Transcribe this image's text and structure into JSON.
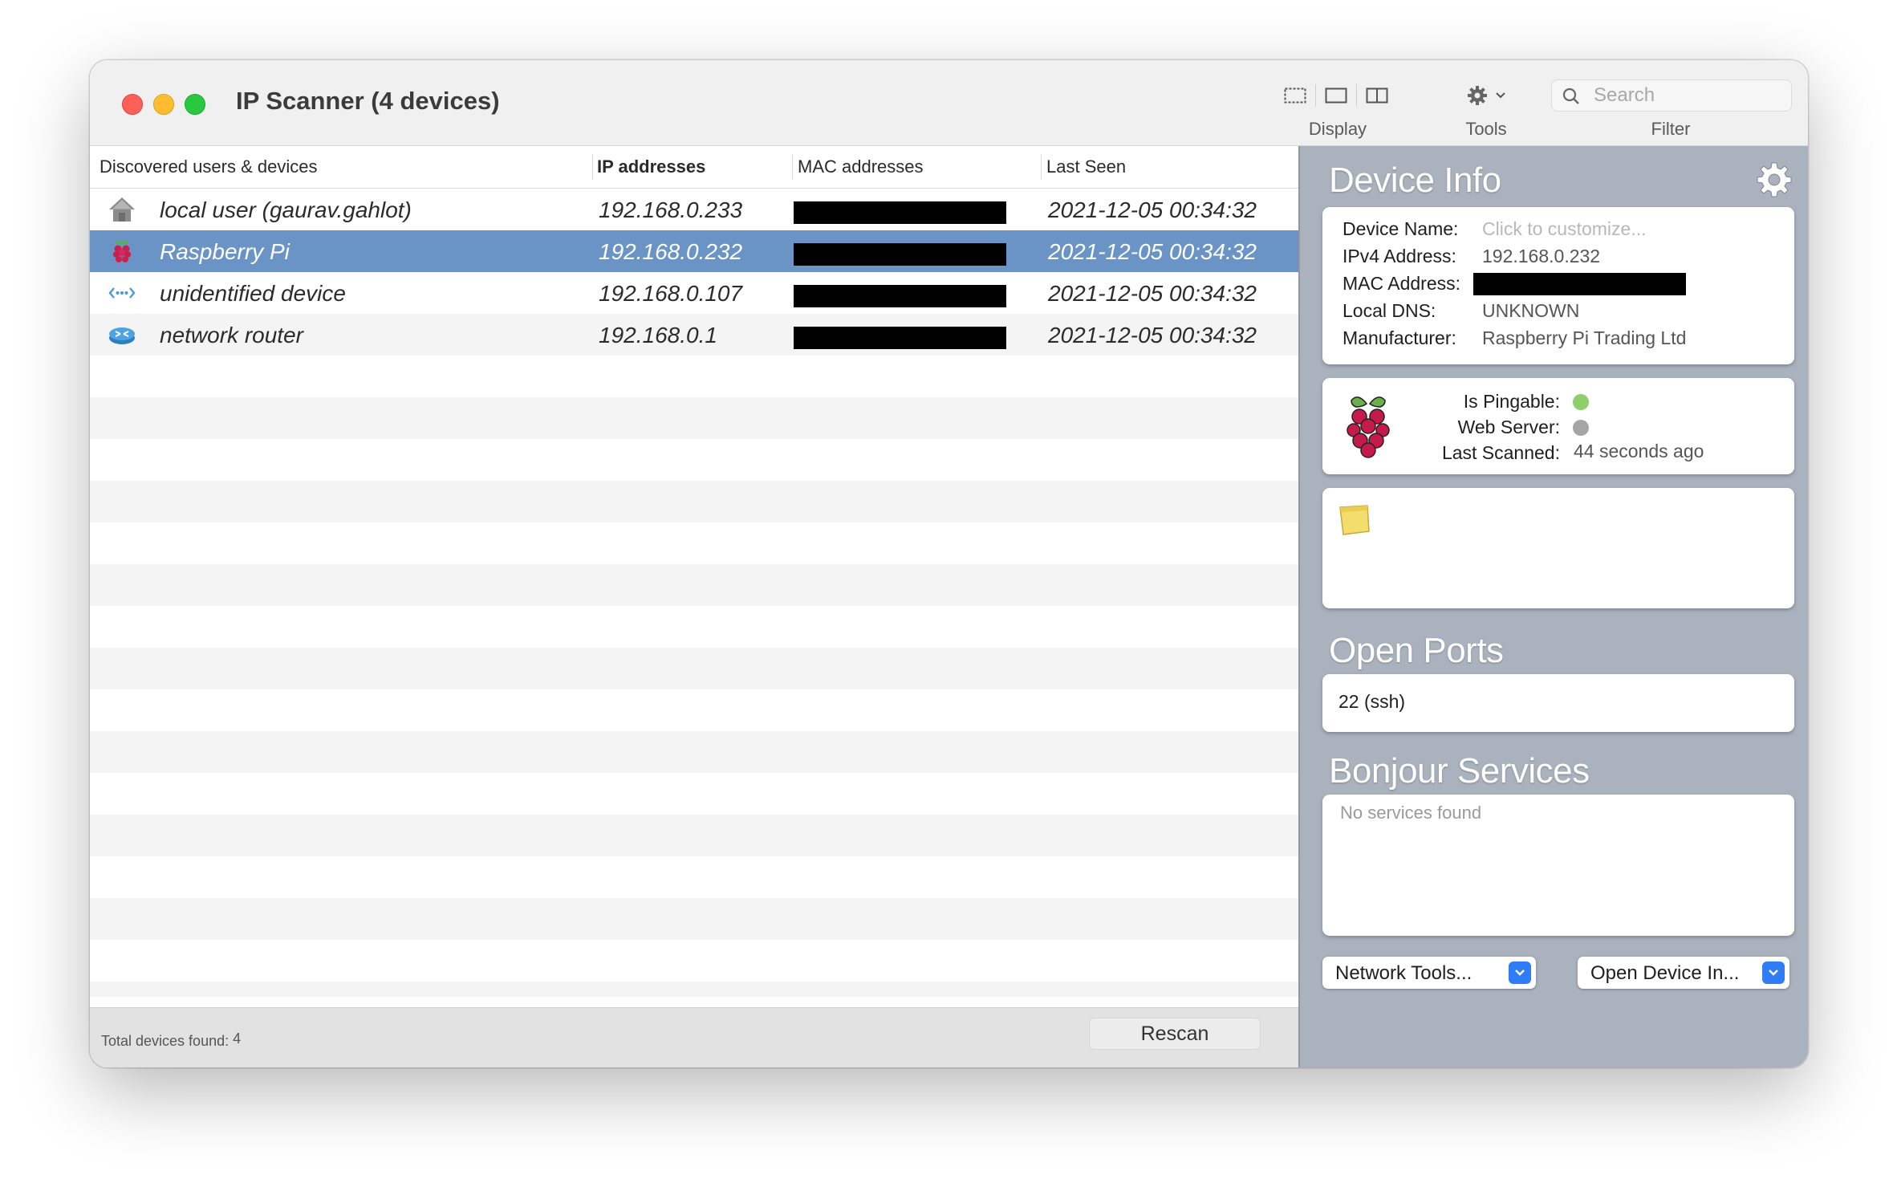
{
  "window": {
    "title": "IP Scanner (4 devices)"
  },
  "toolbar": {
    "display_label": "Display",
    "tools_label": "Tools",
    "filter_label": "Filter",
    "search_placeholder": "Search",
    "search_value": ""
  },
  "table": {
    "columns": [
      "Discovered users & devices",
      "IP addresses",
      "MAC addresses",
      "Last Seen"
    ],
    "rows": [
      {
        "icon": "home-icon",
        "name": "local user (gaurav.gahlot)",
        "ip": "192.168.0.233",
        "mac": "[redacted]",
        "last_seen": "2021-12-05 00:34:32",
        "selected": false
      },
      {
        "icon": "raspberry-pi-icon",
        "name": "Raspberry Pi",
        "ip": "192.168.0.232",
        "mac": "[redacted]",
        "last_seen": "2021-12-05 00:34:32",
        "selected": true
      },
      {
        "icon": "network-dots-icon",
        "name": "unidentified device",
        "ip": "192.168.0.107",
        "mac": "[redacted]",
        "last_seen": "2021-12-05 00:34:32",
        "selected": false
      },
      {
        "icon": "router-icon",
        "name": "network router",
        "ip": "192.168.0.1",
        "mac": "[redacted]",
        "last_seen": "2021-12-05 00:34:32",
        "selected": false
      }
    ]
  },
  "status": {
    "label": "Total devices found:",
    "count": "4",
    "rescan_label": "Rescan"
  },
  "device_info": {
    "title": "Device Info",
    "device_name_label": "Device Name:",
    "device_name_placeholder": "Click to customize...",
    "ipv4_label": "IPv4 Address:",
    "ipv4_value": "192.168.0.232",
    "mac_label": "MAC Address:",
    "mac_value": "[redacted]",
    "dns_label": "Local DNS:",
    "dns_value": "UNKNOWN",
    "manufacturer_label": "Manufacturer:",
    "manufacturer_value": "Raspberry Pi Trading Ltd"
  },
  "status_card": {
    "pingable_label": "Is Pingable:",
    "pingable_color": "#8fcf6a",
    "webserver_label": "Web Server:",
    "webserver_color": "#a5a5a5",
    "last_scanned_label": "Last Scanned:",
    "last_scanned_value": "44 seconds ago"
  },
  "open_ports": {
    "title": "Open Ports",
    "items": [
      "22 (ssh)"
    ]
  },
  "bonjour": {
    "title": "Bonjour Services",
    "empty_text": "No services found"
  },
  "actions": {
    "network_tools_label": "Network Tools...",
    "open_device_label": "Open Device In..."
  }
}
